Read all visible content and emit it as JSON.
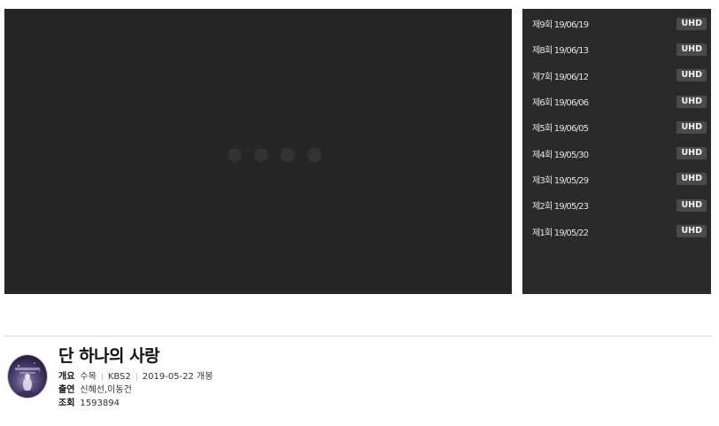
{
  "player": {
    "background": "#262626"
  },
  "episodes": [
    {
      "label": "제9회 19/06/19",
      "badge": "UHD"
    },
    {
      "label": "제8회 19/06/13",
      "badge": "UHD"
    },
    {
      "label": "제7회 19/06/12",
      "badge": "UHD"
    },
    {
      "label": "제6회 19/06/06",
      "badge": "UHD"
    },
    {
      "label": "제5회 19/06/05",
      "badge": "UHD"
    },
    {
      "label": "제4회 19/05/30",
      "badge": "UHD"
    },
    {
      "label": "제3회 19/05/29",
      "badge": "UHD"
    },
    {
      "label": "제2회 19/05/23",
      "badge": "UHD"
    },
    {
      "label": "제1회 19/05/22",
      "badge": "UHD"
    }
  ],
  "program": {
    "title": "단 하나의 사랑",
    "overview_label": "개요",
    "overview_day": "수목",
    "overview_channel": "KBS2",
    "overview_date": "2019-05-22 개봉",
    "cast_label": "출연",
    "cast": "신혜선,이동건",
    "views_label": "조회",
    "views": "1593894"
  }
}
